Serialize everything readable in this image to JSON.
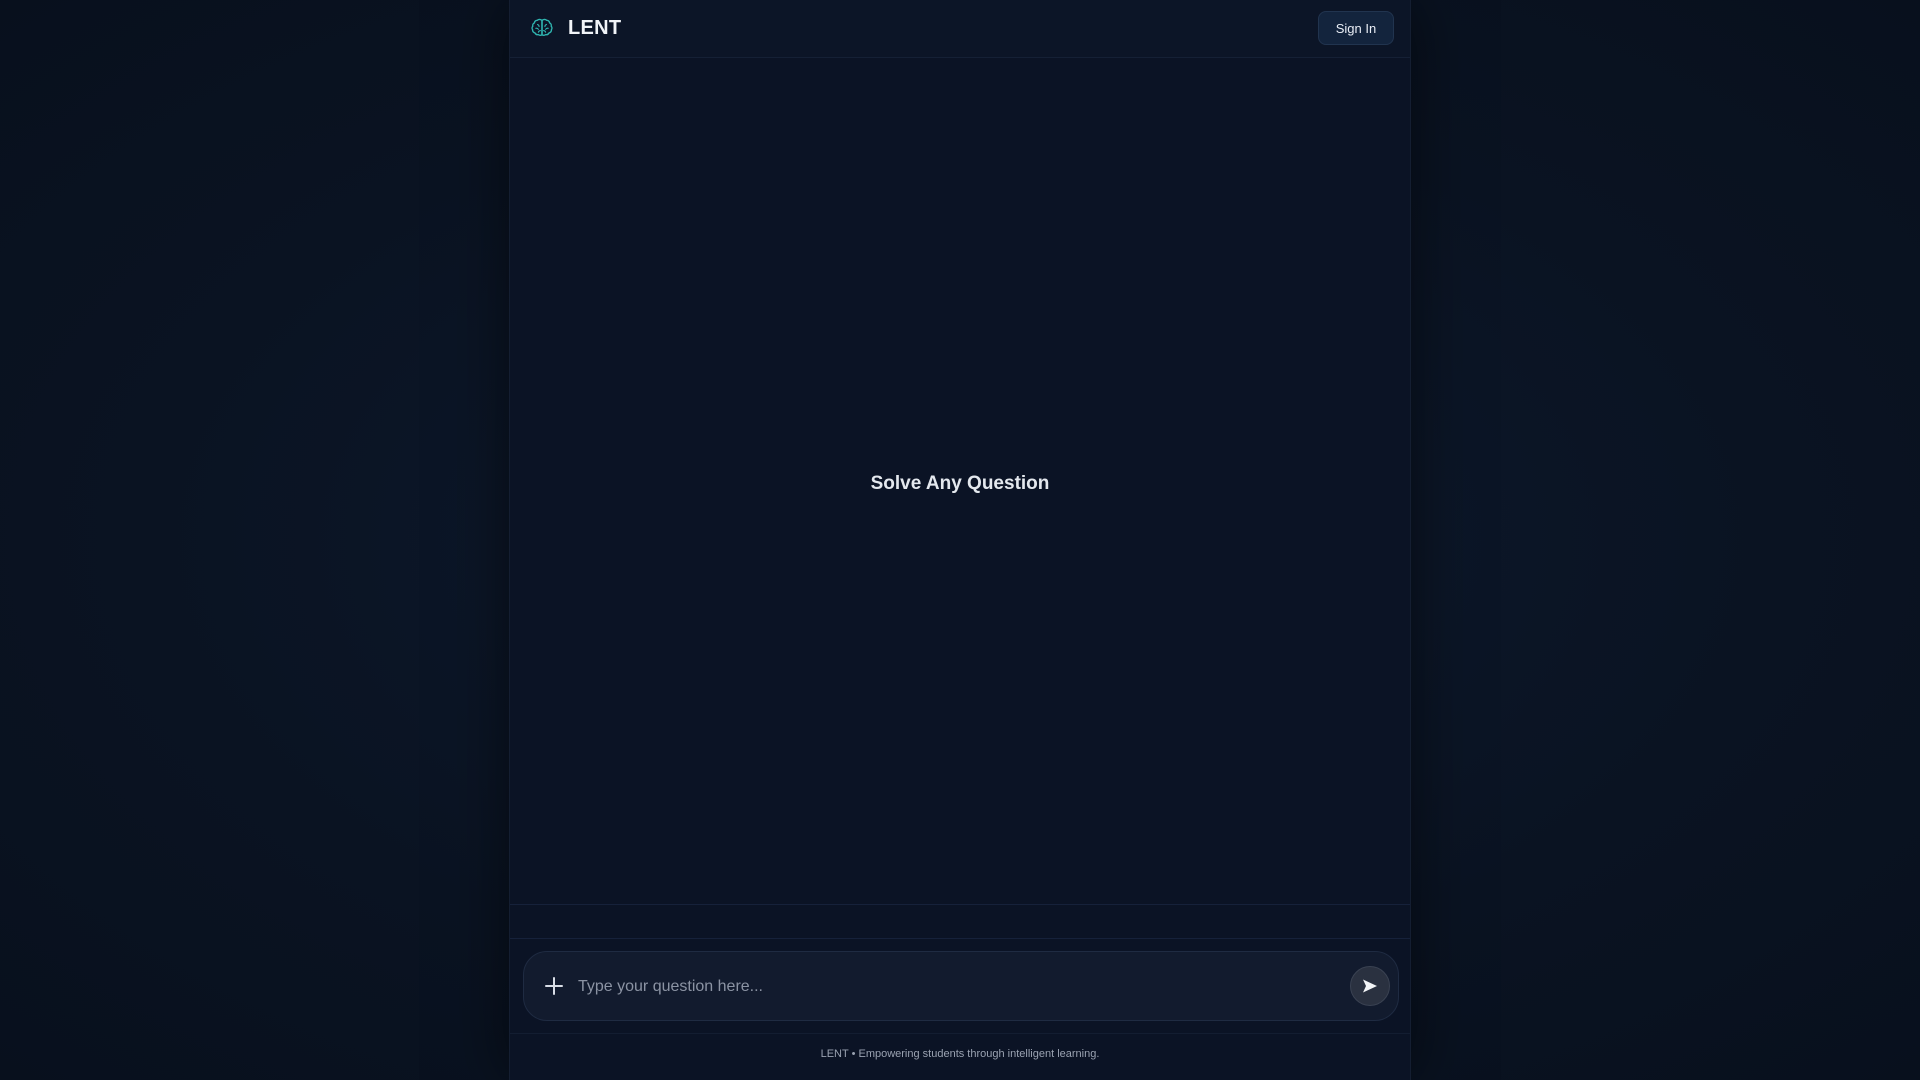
{
  "header": {
    "brand_name": "LENT",
    "brand_icon": "brain-icon",
    "signin_label": "Sign In"
  },
  "main": {
    "hero_title": "Solve Any Question"
  },
  "composer": {
    "attach_icon": "plus-icon",
    "placeholder": "Type your question here...",
    "value": "",
    "send_icon": "send-icon"
  },
  "footer": {
    "tagline": "LENT • Empowering students through intelligent learning."
  },
  "colors": {
    "accent": "#2fb5b0",
    "background": "#0b1325",
    "button_bg": "#13243d"
  }
}
